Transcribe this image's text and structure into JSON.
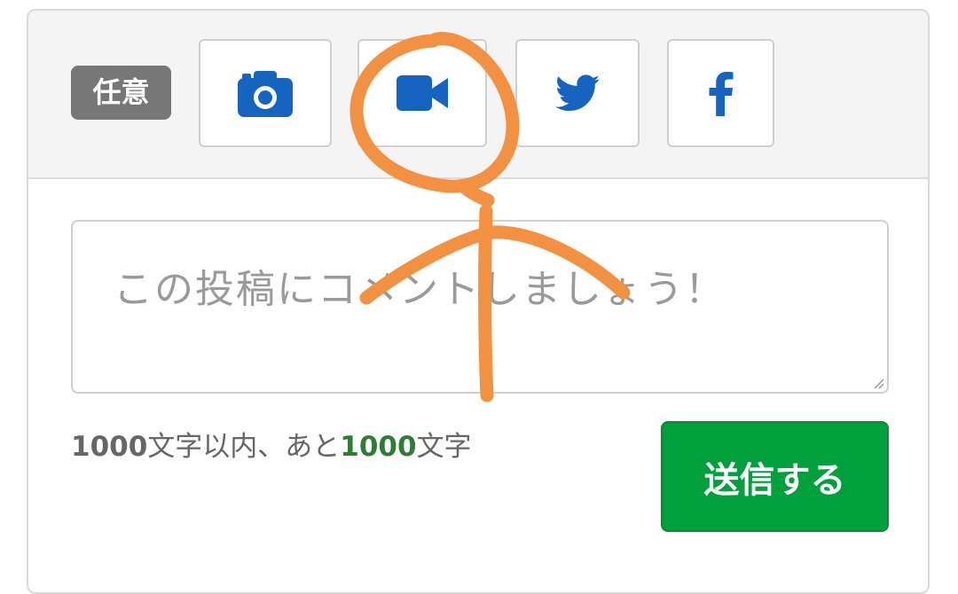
{
  "toolbar": {
    "badge_label": "任意",
    "buttons": [
      {
        "icon": "camera-icon"
      },
      {
        "icon": "video-camera-icon"
      },
      {
        "icon": "twitter-icon"
      },
      {
        "icon": "facebook-icon"
      }
    ]
  },
  "comment": {
    "placeholder": "この投稿にコメントしましょう！",
    "counter": {
      "limit": "1000",
      "limit_suffix": "文字以内、あと",
      "remaining": "1000",
      "remaining_suffix": "文字"
    },
    "submit_label": "送信する"
  },
  "colors": {
    "icon_blue": "#1565c0",
    "submit_green": "#00a03c",
    "badge_gray": "#777777",
    "remaining_green": "#2e7d32",
    "annotation_orange": "#f29142"
  }
}
